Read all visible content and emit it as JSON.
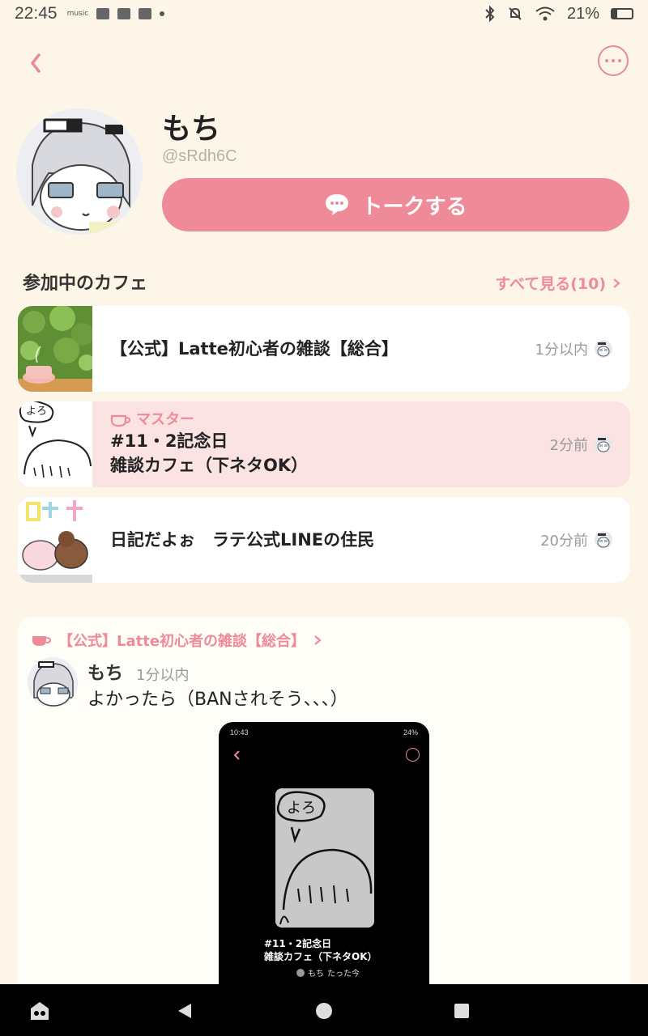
{
  "status_bar": {
    "time": "22:45",
    "left_icons": [
      "music-icon",
      "image-icon",
      "app-icon",
      "app-icon"
    ],
    "left_icon_text": "music",
    "battery": "21%"
  },
  "profile": {
    "name": "もち",
    "handle": "@sRdh6C",
    "talk_button": "トークする"
  },
  "cafes_section": {
    "title": "参加中のカフェ",
    "see_all": "すべて見る(10)",
    "items": [
      {
        "title": "【公式】Latte初心者の雑談【総合】",
        "time": "1分以内",
        "role": ""
      },
      {
        "title_line1": "#11・2記念日",
        "title_line2": "雑談カフェ（下ネタOK）",
        "time": "2分前",
        "role": "マスター"
      },
      {
        "title": "日記だよぉ　ラテ公式LINEの住民",
        "time": "20分前",
        "role": ""
      }
    ]
  },
  "post": {
    "cafe": "【公式】Latte初心者の雑談【総合】",
    "author": "もち",
    "time": "1分以内",
    "text": "よかったら（BANされそう、、、）",
    "image": {
      "status_time": "10:43",
      "status_battery": "24%",
      "title_line1": "#11・2記念日",
      "title_line2": "雑談カフェ（下ネタOK）",
      "author": "もち",
      "time": "たった今",
      "drawn_text": "よろ"
    }
  },
  "colors": {
    "background": "#fdf6e8",
    "accent": "#ef8b98",
    "master_card": "#fbe3e4"
  }
}
